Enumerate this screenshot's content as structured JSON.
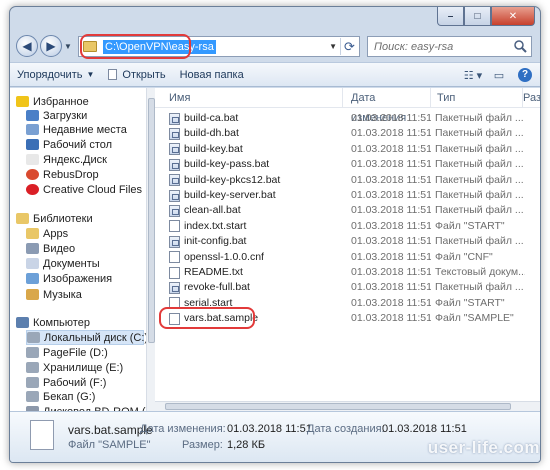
{
  "address": {
    "path": "C:\\OpenVPN\\easy-rsa"
  },
  "search": {
    "placeholder": "Поиск: easy-rsa"
  },
  "toolbar": {
    "organize": "Упорядочить",
    "open": "Открыть",
    "new_folder": "Новая папка"
  },
  "columns": {
    "name": "Имя",
    "date": "Дата изменения",
    "type": "Тип",
    "size": "Разме"
  },
  "sidebar": [
    {
      "label": "Избранное",
      "icon": "star-icon",
      "level": 0
    },
    {
      "label": "Загрузки",
      "icon": "downloads-icon",
      "level": 1
    },
    {
      "label": "Недавние места",
      "icon": "recent-places-icon",
      "level": 1
    },
    {
      "label": "Рабочий стол",
      "icon": "desktop-icon",
      "level": 1
    },
    {
      "label": "Яндекс.Диск",
      "icon": "yandex-disk-icon",
      "level": 1
    },
    {
      "label": "RebusDrop",
      "icon": "rebusdrop-icon",
      "level": 1
    },
    {
      "label": "Creative Cloud Files",
      "icon": "creative-cloud-icon",
      "level": 1
    },
    {
      "label": "Библиотеки",
      "icon": "libraries-icon",
      "level": 0
    },
    {
      "label": "Apps",
      "icon": "folder-icon",
      "level": 1
    },
    {
      "label": "Видео",
      "icon": "video-icon",
      "level": 1
    },
    {
      "label": "Документы",
      "icon": "documents-icon",
      "level": 1
    },
    {
      "label": "Изображения",
      "icon": "pictures-icon",
      "level": 1
    },
    {
      "label": "Музыка",
      "icon": "music-icon",
      "level": 1
    },
    {
      "label": "Компьютер",
      "icon": "computer-icon",
      "level": 0
    },
    {
      "label": "Локальный диск (C:)",
      "icon": "drive-icon",
      "level": 1,
      "selected": true
    },
    {
      "label": "PageFile (D:)",
      "icon": "drive-icon",
      "level": 1
    },
    {
      "label": "Хранилище (E:)",
      "icon": "drive-icon",
      "level": 1
    },
    {
      "label": "Рабочий (F:)",
      "icon": "drive-icon",
      "level": 1
    },
    {
      "label": "Бекап (G:)",
      "icon": "drive-icon",
      "level": 1
    },
    {
      "label": "Дисковод BD-ROM (I:",
      "icon": "disc-drive-icon",
      "level": 1
    }
  ],
  "files": [
    {
      "name": "build-ca.bat",
      "date": "01.03.2018 11:51",
      "type": "Пакетный файл ...",
      "kind": "bat"
    },
    {
      "name": "build-dh.bat",
      "date": "01.03.2018 11:51",
      "type": "Пакетный файл ...",
      "kind": "bat"
    },
    {
      "name": "build-key.bat",
      "date": "01.03.2018 11:51",
      "type": "Пакетный файл ...",
      "kind": "bat"
    },
    {
      "name": "build-key-pass.bat",
      "date": "01.03.2018 11:51",
      "type": "Пакетный файл ...",
      "kind": "bat"
    },
    {
      "name": "build-key-pkcs12.bat",
      "date": "01.03.2018 11:51",
      "type": "Пакетный файл ...",
      "kind": "bat"
    },
    {
      "name": "build-key-server.bat",
      "date": "01.03.2018 11:51",
      "type": "Пакетный файл ...",
      "kind": "bat"
    },
    {
      "name": "clean-all.bat",
      "date": "01.03.2018 11:51",
      "type": "Пакетный файл ...",
      "kind": "bat"
    },
    {
      "name": "index.txt.start",
      "date": "01.03.2018 11:51",
      "type": "Файл \"START\"",
      "kind": "file"
    },
    {
      "name": "init-config.bat",
      "date": "01.03.2018 11:51",
      "type": "Пакетный файл ...",
      "kind": "bat"
    },
    {
      "name": "openssl-1.0.0.cnf",
      "date": "01.03.2018 11:51",
      "type": "Файл \"CNF\"",
      "kind": "file"
    },
    {
      "name": "README.txt",
      "date": "01.03.2018 11:51",
      "type": "Текстовый докум...",
      "kind": "file"
    },
    {
      "name": "revoke-full.bat",
      "date": "01.03.2018 11:51",
      "type": "Пакетный файл ...",
      "kind": "bat"
    },
    {
      "name": "serial.start",
      "date": "01.03.2018 11:51",
      "type": "Файл \"START\"",
      "kind": "file"
    },
    {
      "name": "vars.bat.sample",
      "date": "01.03.2018 11:51",
      "type": "Файл \"SAMPLE\"",
      "kind": "file",
      "highlighted": true
    }
  ],
  "details": {
    "file_name": "vars.bat.sample",
    "file_type": "Файл \"SAMPLE\"",
    "modified_label": "Дата изменения:",
    "modified_value": "01.03.2018 11:51",
    "created_label": "Дата создания:",
    "created_value": "01.03.2018 11:51",
    "size_label": "Размер:",
    "size_value": "1,28 КБ"
  },
  "watermark": "user-life.com",
  "colors": {
    "highlight_red": "#e23a3a",
    "address_selection": "#3399ff",
    "folder_yellow": "#e9c767"
  }
}
